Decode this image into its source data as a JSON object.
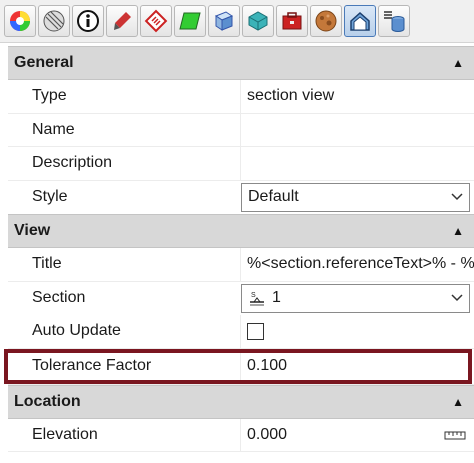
{
  "toolbar": {
    "icons": [
      {
        "name": "color-wheel-icon",
        "active": false
      },
      {
        "name": "pattern-icon",
        "active": false
      },
      {
        "name": "info-icon",
        "active": false
      },
      {
        "name": "brush-icon",
        "active": false
      },
      {
        "name": "hatch-icon",
        "active": false
      },
      {
        "name": "surface-icon",
        "active": false
      },
      {
        "name": "cube-icon",
        "active": false
      },
      {
        "name": "solid-icon",
        "active": false
      },
      {
        "name": "toolbox-icon",
        "active": false
      },
      {
        "name": "texture-icon",
        "active": false
      },
      {
        "name": "section-view-icon",
        "active": true
      },
      {
        "name": "database-icon",
        "active": false
      }
    ]
  },
  "general": {
    "header": "General",
    "type_label": "Type",
    "type_value": "section view",
    "name_label": "Name",
    "name_value": "",
    "description_label": "Description",
    "description_value": "",
    "style_label": "Style",
    "style_value": "Default"
  },
  "view": {
    "header": "View",
    "title_label": "Title",
    "title_value": "%<section.referenceText>% - %<",
    "section_label": "Section",
    "section_value": "1",
    "auto_update_label": "Auto Update",
    "auto_update_checked": false,
    "tolerance_label": "Tolerance Factor",
    "tolerance_value": "0.100"
  },
  "location": {
    "header": "Location",
    "elevation_label": "Elevation",
    "elevation_value": "0.000"
  },
  "colors": {
    "highlight": "#7a1620",
    "section_header": "#d8d8d8"
  }
}
